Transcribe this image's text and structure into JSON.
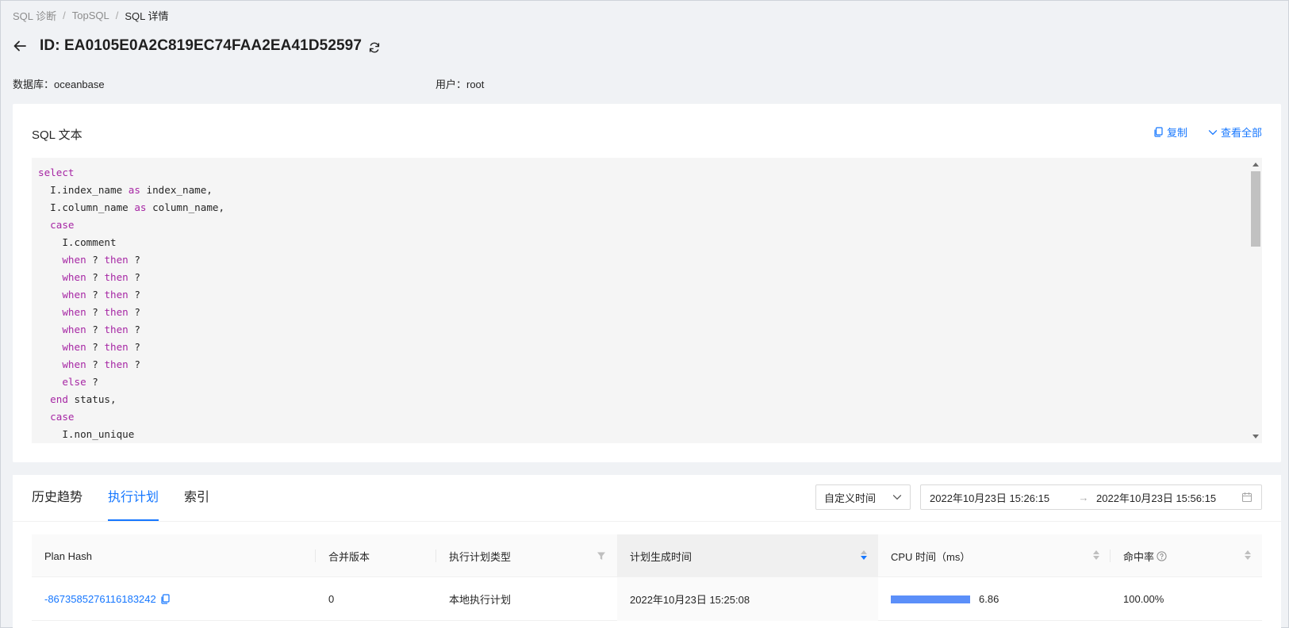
{
  "breadcrumb": {
    "items": [
      "SQL 诊断",
      "TopSQL",
      "SQL 详情"
    ]
  },
  "header": {
    "title": "ID: EA0105E0A2C819EC74FAA2EA41D52597"
  },
  "meta": {
    "database": "数据库：oceanbase",
    "user": "用户：root"
  },
  "sql_card": {
    "title": "SQL 文本",
    "copy_label": "复制",
    "view_all_label": "查看全部",
    "lines": [
      [
        {
          "t": "select",
          "kw": true
        }
      ],
      [
        {
          "t": "  I.index_name "
        },
        {
          "t": "as",
          "kw": true
        },
        {
          "t": " index_name,"
        }
      ],
      [
        {
          "t": "  I.column_name "
        },
        {
          "t": "as",
          "kw": true
        },
        {
          "t": " column_name,"
        }
      ],
      [
        {
          "t": "  "
        },
        {
          "t": "case",
          "kw": true
        }
      ],
      [
        {
          "t": "    I.comment"
        }
      ],
      [
        {
          "t": "    "
        },
        {
          "t": "when",
          "kw": true
        },
        {
          "t": " ? "
        },
        {
          "t": "then",
          "kw": true
        },
        {
          "t": " ?"
        }
      ],
      [
        {
          "t": "    "
        },
        {
          "t": "when",
          "kw": true
        },
        {
          "t": " ? "
        },
        {
          "t": "then",
          "kw": true
        },
        {
          "t": " ?"
        }
      ],
      [
        {
          "t": "    "
        },
        {
          "t": "when",
          "kw": true
        },
        {
          "t": " ? "
        },
        {
          "t": "then",
          "kw": true
        },
        {
          "t": " ?"
        }
      ],
      [
        {
          "t": "    "
        },
        {
          "t": "when",
          "kw": true
        },
        {
          "t": " ? "
        },
        {
          "t": "then",
          "kw": true
        },
        {
          "t": " ?"
        }
      ],
      [
        {
          "t": "    "
        },
        {
          "t": "when",
          "kw": true
        },
        {
          "t": " ? "
        },
        {
          "t": "then",
          "kw": true
        },
        {
          "t": " ?"
        }
      ],
      [
        {
          "t": "    "
        },
        {
          "t": "when",
          "kw": true
        },
        {
          "t": " ? "
        },
        {
          "t": "then",
          "kw": true
        },
        {
          "t": " ?"
        }
      ],
      [
        {
          "t": "    "
        },
        {
          "t": "when",
          "kw": true
        },
        {
          "t": " ? "
        },
        {
          "t": "then",
          "kw": true
        },
        {
          "t": " ?"
        }
      ],
      [
        {
          "t": "    "
        },
        {
          "t": "else",
          "kw": true
        },
        {
          "t": " ?"
        }
      ],
      [
        {
          "t": "  "
        },
        {
          "t": "end",
          "kw": true
        },
        {
          "t": " status,"
        }
      ],
      [
        {
          "t": "  "
        },
        {
          "t": "case",
          "kw": true
        }
      ],
      [
        {
          "t": "    I.non_unique"
        }
      ]
    ]
  },
  "tabs": {
    "items": [
      "历史趋势",
      "执行计划",
      "索引"
    ],
    "active": 1
  },
  "time_filter": {
    "select_value": "自定义时间",
    "range_start": "2022年10月23日 15:26:15",
    "range_separator": "→",
    "range_end": "2022年10月23日 15:56:15"
  },
  "table": {
    "columns": [
      "Plan Hash",
      "合并版本",
      "执行计划类型",
      "计划生成时间",
      "CPU 时间（ms）",
      "命中率"
    ],
    "rows": [
      {
        "plan_hash": "-8673585276116183242",
        "merge_version": "0",
        "plan_type": "本地执行计划",
        "generated_at": "2022年10月23日 15:25:08",
        "cpu_time": "6.86",
        "cpu_bar_fraction": 1.0,
        "hit_rate": "100.00%"
      }
    ]
  },
  "colors": {
    "accent": "#1677ff",
    "keyword": "#a626a4",
    "bar": "#5b8ff9"
  }
}
